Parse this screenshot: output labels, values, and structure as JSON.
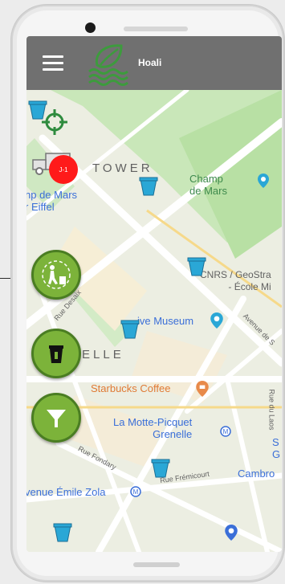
{
  "app": {
    "title": "Hoali"
  },
  "map": {
    "labels": {
      "tower": "TOWER",
      "champ_de_mars": "Champ\nde Mars",
      "champ_de_mars_eiffel": "np de Mars\nr Eiffel",
      "cnrs": "CNRS / GeoStra\n- École Mi",
      "rue_desaix": "Rue Desaix",
      "museum": "ive Museum",
      "avenue": "Avenue de S",
      "elle": "ELLE",
      "starbucks": "Starbucks Coffee",
      "rue_du_laos": "Rue du Laos",
      "la_motte_picquet": "La Motte-Picquet\nGrenelle",
      "rue_fondary": "Rue Fondary",
      "rue_fremicourt": "Rue Frémicourt",
      "cambro": "Cambro",
      "avenue_emile_zola": "venue Émile Zola",
      "s_g": "S\nG"
    },
    "badge": "J-1"
  },
  "icons": {
    "menu": "hamburger-menu-icon",
    "logo": "leaf-water-logo",
    "locate": "crosshair-locate-icon",
    "truck": "garbage-truck-icon",
    "cup": "trash-bin-marker-icon",
    "trash_person": "person-throwing-trash-icon",
    "bin": "trash-bin-icon",
    "filter": "filter-funnel-icon",
    "metro": "metro-icon",
    "museum_pin": "museum-pin-icon",
    "coffee_pin": "coffee-pin-icon"
  },
  "colors": {
    "appbar": "#707070",
    "accent": "#7cb33a",
    "badge": "#ff1a1a",
    "marker": "#2aa7d6"
  }
}
